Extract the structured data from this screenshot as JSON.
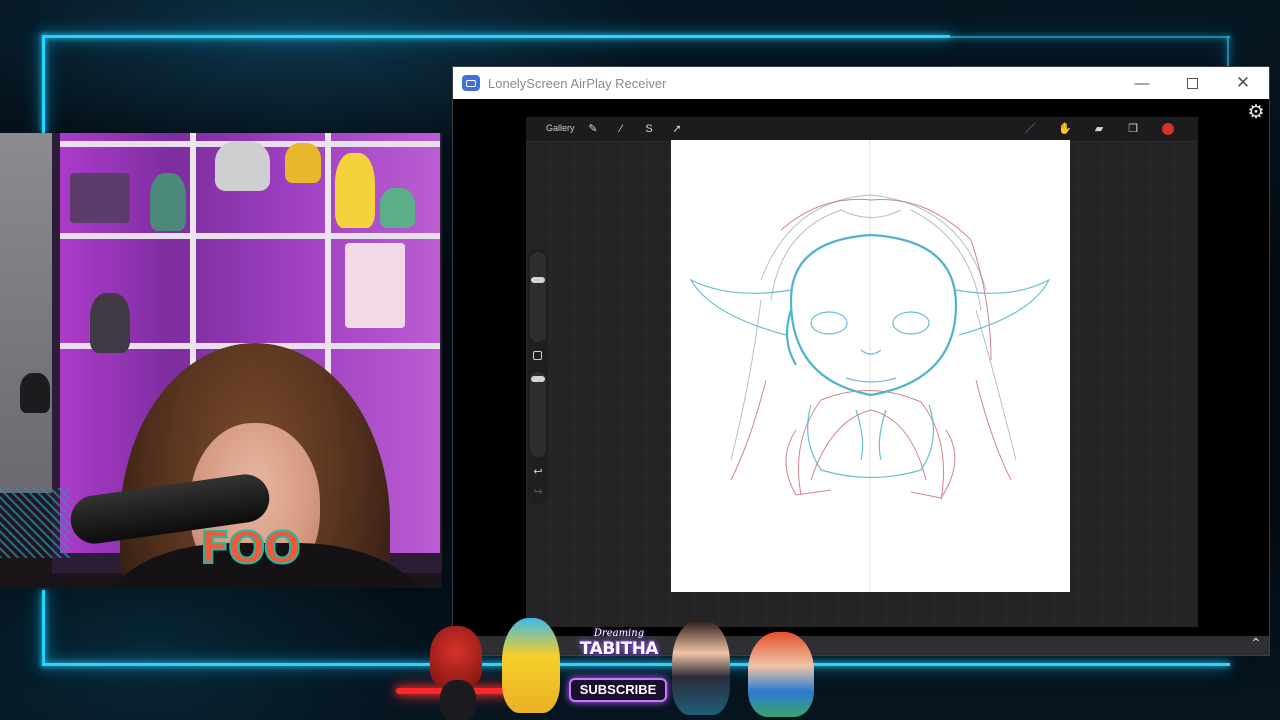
{
  "window": {
    "title": "LonelyScreen AirPlay Receiver",
    "minimize_icon": "—",
    "close_icon": "✕",
    "settings_icon": "⚙",
    "expand_icon": "⌃"
  },
  "procreate": {
    "gallery_label": "Gallery",
    "tools": [
      {
        "name": "wrench-icon",
        "glyph": "✎"
      },
      {
        "name": "adjustments-icon",
        "glyph": "⁄"
      },
      {
        "name": "selection-icon",
        "glyph": "S"
      },
      {
        "name": "transform-icon",
        "glyph": "➚"
      },
      {
        "name": "brush-icon",
        "glyph": "／"
      },
      {
        "name": "smudge-icon",
        "glyph": "✋"
      },
      {
        "name": "eraser-icon",
        "glyph": "▰"
      },
      {
        "name": "layers-icon",
        "glyph": "❐"
      }
    ],
    "undo_icon": "↩",
    "redo_icon": "↪",
    "active_color": "#d9312f"
  },
  "overlay": {
    "channel_script": "Dreaming",
    "channel_name": "TABITHA",
    "subscribe_label": "SUBSCRIBE"
  },
  "webcam": {
    "shirt_text": "FOO"
  },
  "colors": {
    "neon": "#29d4ff",
    "sketch_blue": "#4fb3cc",
    "sketch_red": "#c45a6a"
  }
}
